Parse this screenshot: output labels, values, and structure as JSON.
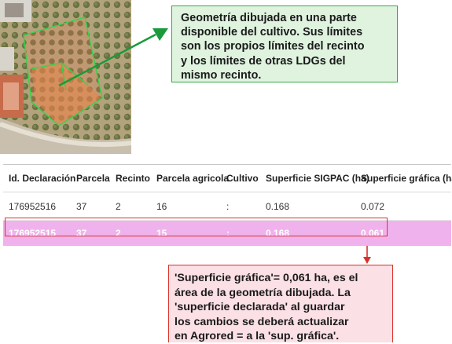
{
  "callout_top": {
    "lines": [
      "Geometría  dibujada en una parte",
      "disponible del cultivo. Sus límites",
      "son los propios límites del recinto",
      "y los límites de otras LDGs del",
      "mismo recinto."
    ]
  },
  "table": {
    "headers": [
      "Id. Declaración",
      "Parcela",
      "Recinto",
      "Parcela agricola",
      "Cultivo",
      "Superficie SIGPAC (ha)",
      "Superficie gráfica (ha)"
    ],
    "rows": [
      [
        "176952516",
        "37",
        "2",
        "16",
        ":",
        "0.168",
        "0.072"
      ],
      [
        "176952515",
        "37",
        "2",
        "15",
        ":",
        "0.168",
        "0.061"
      ]
    ]
  },
  "callout_bottom": {
    "lines": [
      "'Superficie gráfica'= 0,061 ha, es el",
      "área de la geometría dibujada. La",
      "'superficie declarada'  al guardar",
      "los cambios se deberá actualizar",
      "en Agrored = a la 'sup. gráfica'."
    ]
  },
  "colors": {
    "highlight_row": "#f0b2ec",
    "green_accent": "#1a9a3a",
    "red_accent": "#d9322b"
  }
}
